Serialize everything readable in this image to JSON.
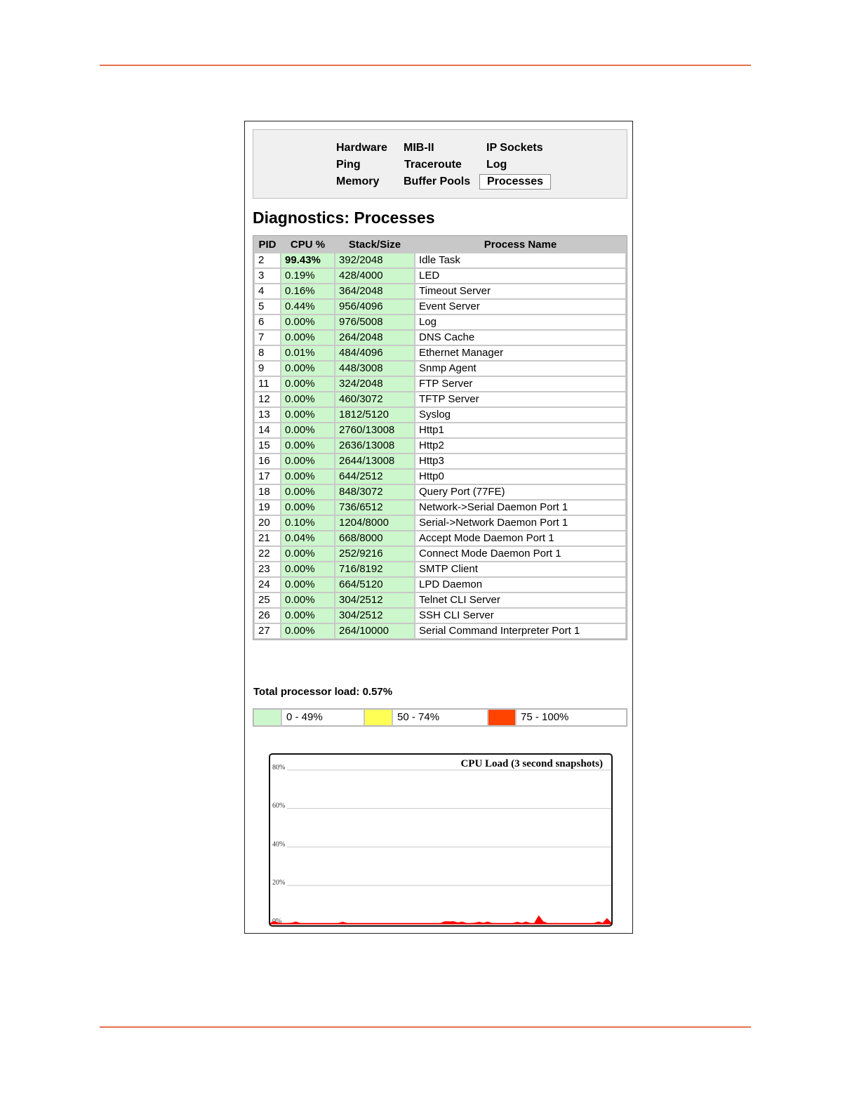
{
  "nav": {
    "items": [
      {
        "label": "Hardware",
        "active": false
      },
      {
        "label": "MIB-II",
        "active": false
      },
      {
        "label": "IP Sockets",
        "active": false
      },
      {
        "label": "Ping",
        "active": false
      },
      {
        "label": "Traceroute",
        "active": false
      },
      {
        "label": "Log",
        "active": false
      },
      {
        "label": "Memory",
        "active": false
      },
      {
        "label": "Buffer Pools",
        "active": false
      },
      {
        "label": "Processes",
        "active": true
      }
    ]
  },
  "page_title": "Diagnostics: Processes",
  "table": {
    "headers": [
      "PID",
      "CPU %",
      "Stack/Size",
      "Process Name"
    ],
    "rows": [
      {
        "pid": "2",
        "cpu": "99.43%",
        "stack": "392/2048",
        "name": "Idle Task"
      },
      {
        "pid": "3",
        "cpu": "0.19%",
        "stack": "428/4000",
        "name": "LED"
      },
      {
        "pid": "4",
        "cpu": "0.16%",
        "stack": "364/2048",
        "name": "Timeout Server"
      },
      {
        "pid": "5",
        "cpu": "0.44%",
        "stack": "956/4096",
        "name": "Event Server"
      },
      {
        "pid": "6",
        "cpu": "0.00%",
        "stack": "976/5008",
        "name": "Log"
      },
      {
        "pid": "7",
        "cpu": "0.00%",
        "stack": "264/2048",
        "name": "DNS Cache"
      },
      {
        "pid": "8",
        "cpu": "0.01%",
        "stack": "484/4096",
        "name": "Ethernet Manager"
      },
      {
        "pid": "9",
        "cpu": "0.00%",
        "stack": "448/3008",
        "name": "Snmp Agent"
      },
      {
        "pid": "11",
        "cpu": "0.00%",
        "stack": "324/2048",
        "name": "FTP Server"
      },
      {
        "pid": "12",
        "cpu": "0.00%",
        "stack": "460/3072",
        "name": "TFTP Server"
      },
      {
        "pid": "13",
        "cpu": "0.00%",
        "stack": "1812/5120",
        "name": "Syslog"
      },
      {
        "pid": "14",
        "cpu": "0.00%",
        "stack": "2760/13008",
        "name": "Http1"
      },
      {
        "pid": "15",
        "cpu": "0.00%",
        "stack": "2636/13008",
        "name": "Http2"
      },
      {
        "pid": "16",
        "cpu": "0.00%",
        "stack": "2644/13008",
        "name": "Http3"
      },
      {
        "pid": "17",
        "cpu": "0.00%",
        "stack": "644/2512",
        "name": "Http0"
      },
      {
        "pid": "18",
        "cpu": "0.00%",
        "stack": "848/3072",
        "name": "Query Port (77FE)"
      },
      {
        "pid": "19",
        "cpu": "0.00%",
        "stack": "736/6512",
        "name": "Network->Serial Daemon Port 1"
      },
      {
        "pid": "20",
        "cpu": "0.10%",
        "stack": "1204/8000",
        "name": "Serial->Network Daemon Port 1"
      },
      {
        "pid": "21",
        "cpu": "0.04%",
        "stack": "668/8000",
        "name": "Accept Mode Daemon Port 1"
      },
      {
        "pid": "22",
        "cpu": "0.00%",
        "stack": "252/9216",
        "name": "Connect Mode Daemon Port 1"
      },
      {
        "pid": "23",
        "cpu": "0.00%",
        "stack": "716/8192",
        "name": "SMTP Client"
      },
      {
        "pid": "24",
        "cpu": "0.00%",
        "stack": "664/5120",
        "name": "LPD Daemon"
      },
      {
        "pid": "25",
        "cpu": "0.00%",
        "stack": "304/2512",
        "name": "Telnet CLI Server"
      },
      {
        "pid": "26",
        "cpu": "0.00%",
        "stack": "304/2512",
        "name": "SSH CLI Server"
      },
      {
        "pid": "27",
        "cpu": "0.00%",
        "stack": "264/10000",
        "name": "Serial Command Interpreter Port 1"
      }
    ]
  },
  "total_load": "Total processor load: 0.57%",
  "legend": [
    {
      "color": "#ccf7cc",
      "label": "0 - 49%"
    },
    {
      "color": "#ffff55",
      "label": "50 - 74%"
    },
    {
      "color": "#ff4400",
      "label": "75 - 100%"
    }
  ],
  "chart_data": {
    "type": "area",
    "title": "CPU Load (3 second snapshots)",
    "y_ticks": [
      "80%",
      "60%",
      "40%",
      "20%",
      "0%"
    ],
    "ylim": [
      0,
      88
    ],
    "grid": true,
    "line_color": "#ff0000",
    "values": [
      0.3,
      1.2,
      0.3,
      0.2,
      0.2,
      0.3,
      0.9,
      0.2,
      0.2,
      0.2,
      0.2,
      0.2,
      0.2,
      0.2,
      0.2,
      0.2,
      0.2,
      0.8,
      0.2,
      0.2,
      0.2,
      0.2,
      0.2,
      0.2,
      0.2,
      0.2,
      0.2,
      0.2,
      0.2,
      0.2,
      0.2,
      0.2,
      0.2,
      0.2,
      0.2,
      0.2,
      0.2,
      0.2,
      0.2,
      0.2,
      0.2,
      1.1,
      1.0,
      1.1,
      0.4,
      0.9,
      0.2,
      0.2,
      0.3,
      0.8,
      0.3,
      0.9,
      0.2,
      0.2,
      0.2,
      0.2,
      0.2,
      0.2,
      0.8,
      0.2,
      0.9,
      0.2,
      0.2,
      4.0,
      1.0,
      0.2,
      0.2,
      0.2,
      0.2,
      0.2,
      0.2,
      0.2,
      0.2,
      0.2,
      0.2,
      0.2,
      0.2,
      1.0,
      0.2,
      2.6,
      0.3
    ]
  }
}
